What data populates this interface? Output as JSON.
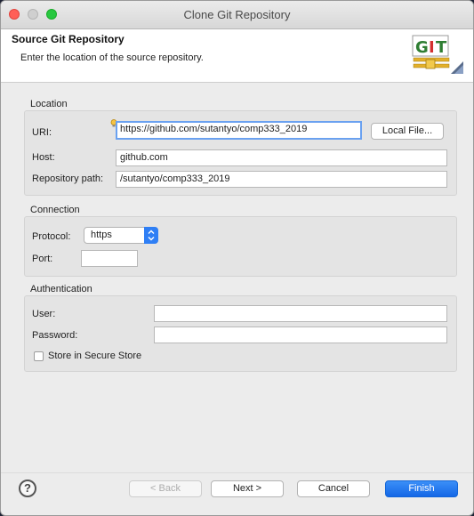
{
  "window": {
    "title": "Clone Git Repository"
  },
  "banner": {
    "title": "Source Git Repository",
    "description": "Enter the location of the source repository.",
    "logo_text": [
      "G",
      "I",
      "T"
    ]
  },
  "location": {
    "section_label": "Location",
    "uri_label": "URI:",
    "uri_value": "https://github.com/sutantyo/comp333_2019",
    "local_file_button": "Local File...",
    "host_label": "Host:",
    "host_value": "github.com",
    "repo_path_label": "Repository path:",
    "repo_path_value": "/sutantyo/comp333_2019"
  },
  "connection": {
    "section_label": "Connection",
    "protocol_label": "Protocol:",
    "protocol_value": "https",
    "port_label": "Port:",
    "port_value": ""
  },
  "authentication": {
    "section_label": "Authentication",
    "user_label": "User:",
    "user_value": "",
    "password_label": "Password:",
    "password_value": "",
    "secure_store_label": "Store in Secure Store",
    "secure_store_checked": false
  },
  "buttons": {
    "help": "?",
    "back": "< Back",
    "next": "Next >",
    "cancel": "Cancel",
    "finish": "Finish"
  },
  "colors": {
    "accent": "#1467e6",
    "focus_ring": "#6aa1f0",
    "close": "#ff5f57",
    "maximize": "#28c840",
    "git_green": "#2e7d32",
    "git_red": "#d32f2f"
  }
}
